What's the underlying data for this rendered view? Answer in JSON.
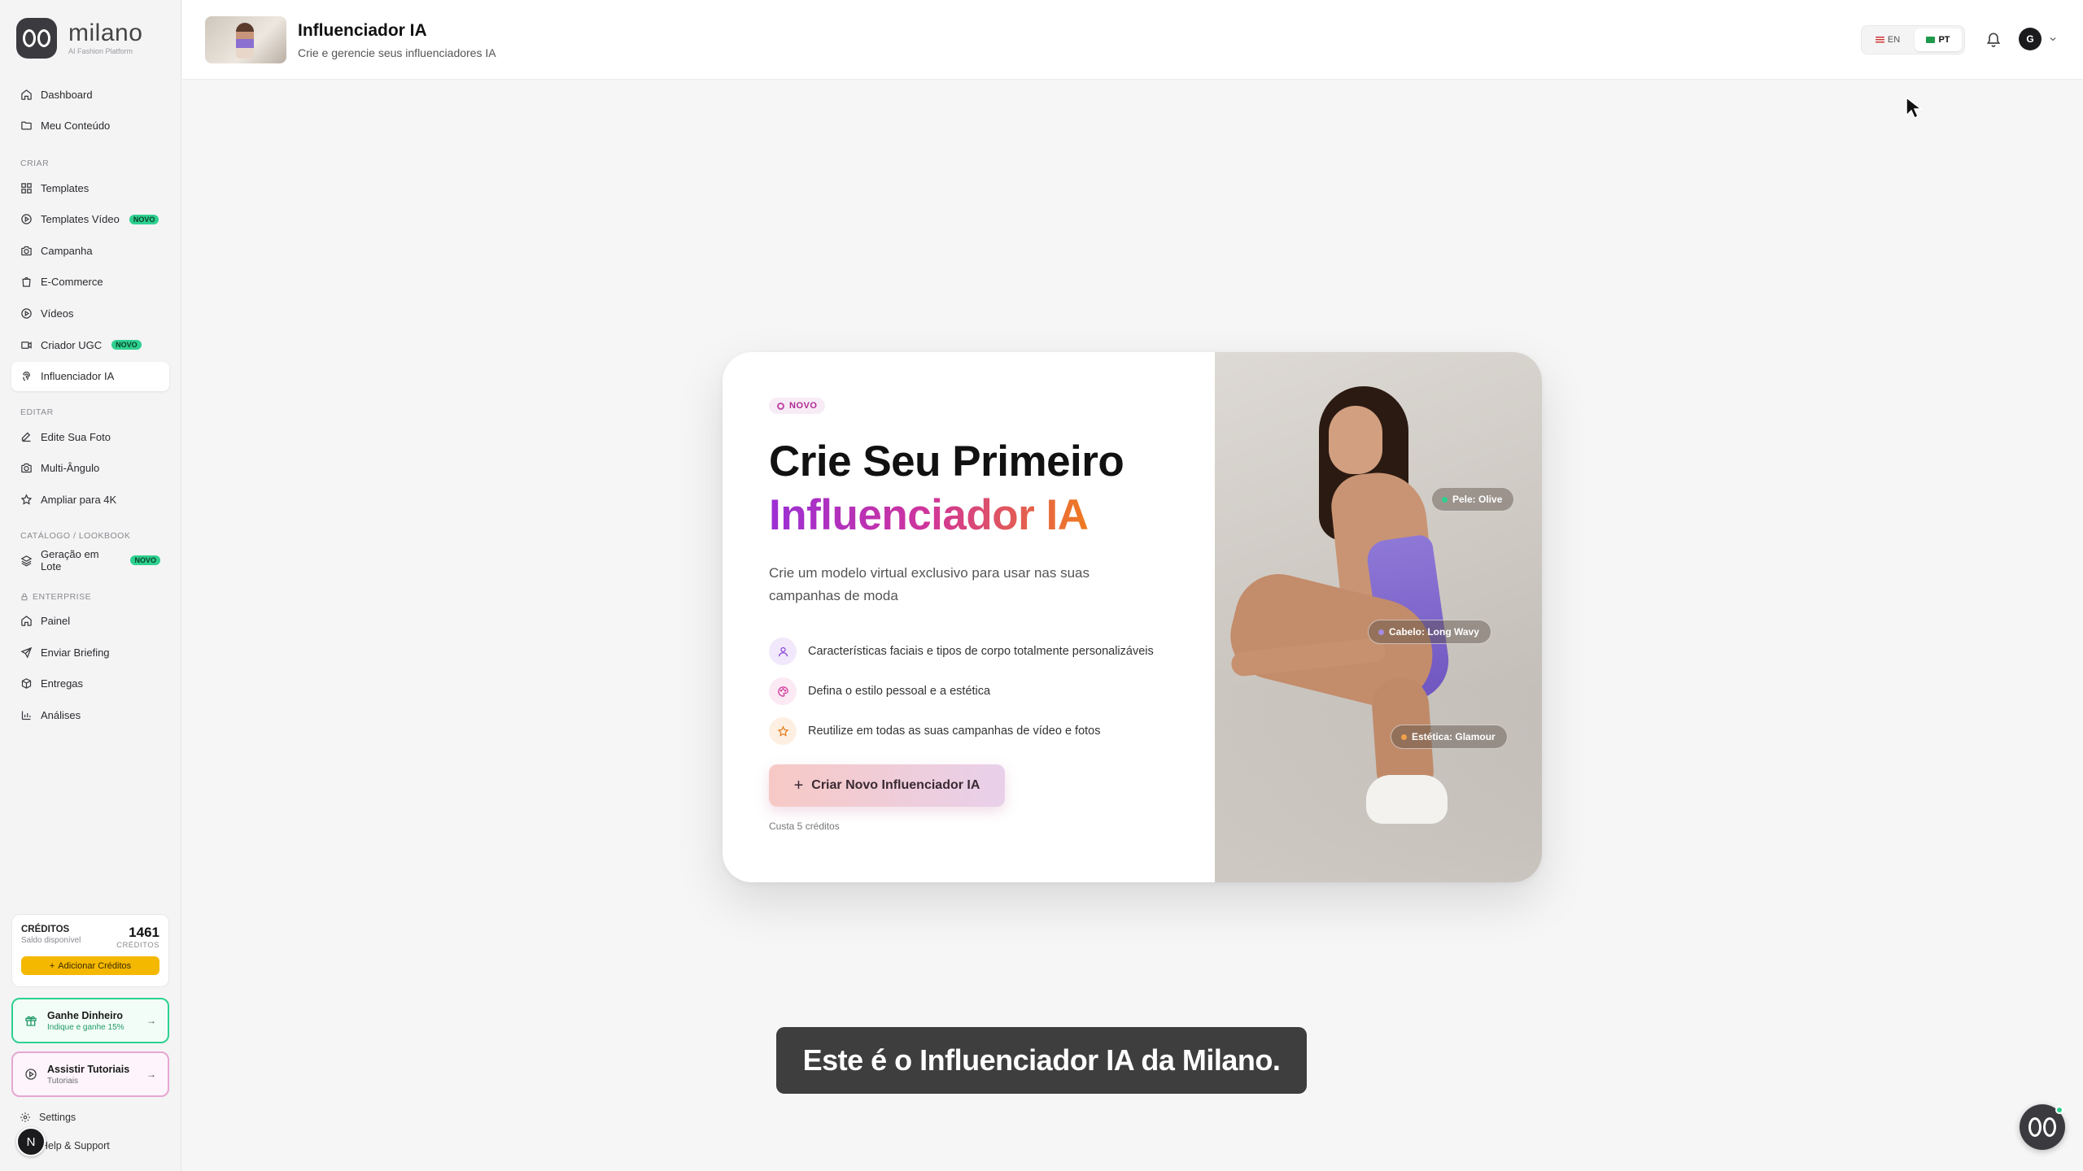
{
  "brand": {
    "name": "milano",
    "tagline": "AI Fashion Platform"
  },
  "sidebar": {
    "top_items": [
      {
        "label": "Dashboard",
        "icon": "home-icon"
      },
      {
        "label": "Meu Conteúdo",
        "icon": "folder-icon"
      }
    ],
    "sections": [
      {
        "title": "CRIAR",
        "items": [
          {
            "label": "Templates",
            "icon": "grid-icon"
          },
          {
            "label": "Templates Vídeo",
            "icon": "play-circle-icon",
            "badge": "NOVO"
          },
          {
            "label": "Campanha",
            "icon": "camera-icon"
          },
          {
            "label": "E-Commerce",
            "icon": "shopping-bag-icon"
          },
          {
            "label": "Vídeos",
            "icon": "play-circle-icon"
          },
          {
            "label": "Criador UGC",
            "icon": "video-icon",
            "badge": "NOVO"
          },
          {
            "label": "Influenciador IA",
            "icon": "fingerprint-icon",
            "active": true
          }
        ]
      },
      {
        "title": "EDITAR",
        "items": [
          {
            "label": "Edite Sua Foto",
            "icon": "edit-icon"
          },
          {
            "label": "Multi-Ângulo",
            "icon": "camera-icon"
          },
          {
            "label": "Ampliar para 4K",
            "icon": "star-icon"
          }
        ]
      },
      {
        "title": "CATÁLOGO / LOOKBOOK",
        "items": [
          {
            "label": "Geração em Lote",
            "icon": "layers-icon",
            "badge": "NOVO"
          }
        ]
      },
      {
        "title": "ENTERPRISE",
        "items": [
          {
            "label": "Painel",
            "icon": "home-icon"
          },
          {
            "label": "Enviar Briefing",
            "icon": "send-icon"
          },
          {
            "label": "Entregas",
            "icon": "package-icon"
          },
          {
            "label": "Análises",
            "icon": "bar-chart-icon"
          }
        ]
      }
    ],
    "credits": {
      "title": "CRÉDITOS",
      "subtitle": "Saldo disponível",
      "amount": "1461",
      "unit": "CRÉDITOS",
      "add_label": "Adicionar Créditos"
    },
    "promo_earn": {
      "title": "Ganhe Dinheiro",
      "subtitle": "Indique e ganhe 15%"
    },
    "promo_tutorials": {
      "title": "Assistir Tutoriais",
      "subtitle": "Tutoriais"
    },
    "settings_label": "Settings",
    "help_label": "Help & Support",
    "user_initial": "N"
  },
  "header": {
    "title": "Influenciador IA",
    "subtitle": "Crie e gerencie seus influenciadores IA",
    "lang_en": "EN",
    "lang_pt": "PT",
    "user_initial": "G"
  },
  "hero": {
    "badge": "NOVO",
    "headline_line1": "Crie Seu Primeiro",
    "headline_line2": "Influenciador IA",
    "description": "Crie um modelo virtual exclusivo para usar nas suas campanhas de moda",
    "features": [
      "Características faciais e tipos de corpo totalmente personalizáveis",
      "Defina o estilo pessoal e a estética",
      "Reutilize em todas as suas campanhas de vídeo e fotos"
    ],
    "cta_label": "Criar Novo Influenciador IA",
    "cost_note": "Custa 5 créditos",
    "tags": [
      {
        "label": "Pele: Olive",
        "color": "#2ed08f"
      },
      {
        "label": "Cabelo: Long Wavy",
        "color": "#a58be0"
      },
      {
        "label": "Estética: Glamour",
        "color": "#f0a04b"
      }
    ]
  },
  "caption": "Este é o Influenciador IA da Milano.",
  "colors": {
    "accent_gradient_start": "#9b2fd6",
    "accent_gradient_end": "#f07b1f",
    "badge_green": "#2ed08f",
    "credits_yellow": "#f5b800"
  }
}
